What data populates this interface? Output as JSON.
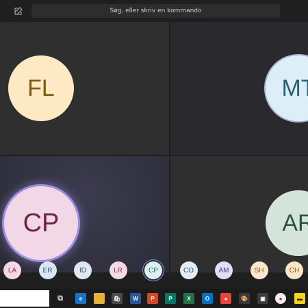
{
  "search": {
    "placeholder": "Søg, eller skriv en kommando"
  },
  "tiles": [
    {
      "initials": "FL",
      "bg": "#fde9c4",
      "fg": "#7a5a14"
    },
    {
      "initials": "MT",
      "bg": "#ddeef7",
      "fg": "#2c5f74"
    },
    {
      "initials": "CP",
      "bg": "#f2d7e6",
      "fg": "#6b2545"
    },
    {
      "initials": "AR",
      "bg": "#d4e4da",
      "fg": "#2e5141"
    }
  ],
  "participants": [
    {
      "initials": "LA",
      "bg": "#f4d8e6",
      "fg": "#8a2a55"
    },
    {
      "initials": "ER",
      "bg": "#dbe5f1",
      "fg": "#34506e"
    },
    {
      "initials": "ID",
      "bg": "#dfe7f3",
      "fg": "#34506e"
    },
    {
      "initials": "LR",
      "bg": "#f6dbe6",
      "fg": "#8a2a55"
    },
    {
      "initials": "CP",
      "bg": "#d9f1ef",
      "fg": "#2f6b66",
      "active": true
    },
    {
      "initials": "CO",
      "bg": "#e4ecf6",
      "fg": "#34506e"
    },
    {
      "initials": "AM",
      "bg": "#e1dcf7",
      "fg": "#4a3b8a"
    },
    {
      "initials": "SH",
      "bg": "#fbe8cc",
      "fg": "#7a5a14"
    },
    {
      "initials": "CH",
      "bg": "#fbe7c8",
      "fg": "#7a5a14"
    }
  ],
  "taskbar": {
    "icons": [
      {
        "name": "task-view-icon",
        "color": "#1b1b1b",
        "glyph": "⧉"
      },
      {
        "name": "edge-icon",
        "color": "#1a73c7",
        "glyph": "e"
      },
      {
        "name": "file-explorer-icon",
        "color": "#e8b23a",
        "glyph": ""
      },
      {
        "name": "store-icon",
        "color": "#4a4a4a",
        "glyph": "🛍"
      },
      {
        "name": "word-icon",
        "color": "#2b579a",
        "glyph": "W"
      },
      {
        "name": "powerpoint-icon",
        "color": "#d24726",
        "glyph": "P"
      },
      {
        "name": "publisher-icon",
        "color": "#077568",
        "glyph": "P"
      },
      {
        "name": "excel-icon",
        "color": "#217346",
        "glyph": "X"
      },
      {
        "name": "outlook-icon",
        "color": "#0072c6",
        "glyph": "O"
      },
      {
        "name": "chrome-icon",
        "color": "#e8453c",
        "glyph": "●"
      },
      {
        "name": "paint-icon",
        "color": "#3a3a3a",
        "glyph": "🎨"
      },
      {
        "name": "app-icon",
        "color": "#3a3a3a",
        "glyph": "▣"
      },
      {
        "name": "record-icon",
        "color": "#f0f0f0",
        "glyph": "●"
      },
      {
        "name": "sticky-notes-icon",
        "color": "#f7d21e",
        "glyph": "▬"
      }
    ]
  }
}
